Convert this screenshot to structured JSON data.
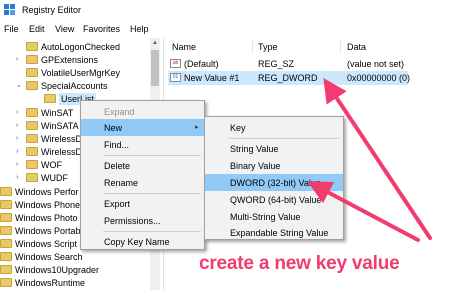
{
  "window": {
    "title": "Registry Editor",
    "icon": "registry-editor-icon"
  },
  "menubar": [
    "File",
    "Edit",
    "View",
    "Favorites",
    "Help"
  ],
  "tree": {
    "items": [
      {
        "label": "AutoLogonChecked"
      },
      {
        "label": "GPExtensions"
      },
      {
        "label": "VolatileUserMgrKey"
      },
      {
        "label": "SpecialAccounts"
      },
      {
        "label": "UserList"
      },
      {
        "label": "WinSAT"
      },
      {
        "label": "WinSATA"
      },
      {
        "label": "WirelessD"
      },
      {
        "label": "WirelessD"
      },
      {
        "label": "WOF"
      },
      {
        "label": "WUDF"
      },
      {
        "label": "Windows Perfor"
      },
      {
        "label": "Windows Phone"
      },
      {
        "label": "Windows Photo"
      },
      {
        "label": "Windows Portab"
      },
      {
        "label": "Windows Script"
      },
      {
        "label": "Windows Search"
      },
      {
        "label": "Windows10Upgrader"
      },
      {
        "label": "WindowsRuntime"
      }
    ]
  },
  "list": {
    "columns": [
      "Name",
      "Type",
      "Data"
    ],
    "rows": [
      {
        "name": "(Default)",
        "type": "REG_SZ",
        "data": "(value not set)",
        "icon": "string-value-icon"
      },
      {
        "name": "New Value #1",
        "type": "REG_DWORD",
        "data": "0x00000000 (0)",
        "icon": "binary-value-icon"
      }
    ]
  },
  "context_menu": {
    "items": [
      "Expand",
      "New",
      "Find...",
      "Delete",
      "Rename",
      "Export",
      "Permissions...",
      "Copy Key Name"
    ]
  },
  "submenu": {
    "items": [
      "Key",
      "String Value",
      "Binary Value",
      "DWORD (32-bit) Value",
      "QWORD (64-bit) Value",
      "Multi-String Value",
      "Expandable String Value"
    ],
    "highlighted": "DWORD (32-bit) Value"
  },
  "annotation": {
    "text": "create a new key value",
    "color": "#f23b6e"
  }
}
